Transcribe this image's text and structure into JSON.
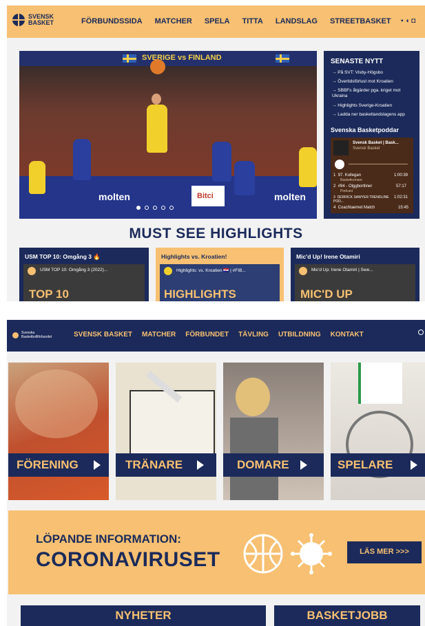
{
  "screen1": {
    "logo": {
      "line1": "SVENSK",
      "line2": "BASKET"
    },
    "nav": [
      "FÖRBUNDSSIDA",
      "MATCHER",
      "SPELA",
      "TITTA",
      "LANDSLAG",
      "STREETBASKET"
    ],
    "hero": {
      "banner_text": "SVERIGE vs FINLAND",
      "sponsor_left": "molten",
      "sponsor_right": "molten",
      "sponsor_mid": "Bitci",
      "slides": 5,
      "active_slide": 1
    },
    "news": {
      "title": "SENASTE NYTT",
      "items": [
        "→ På SVT: Visby-Högsbo",
        "→ Övertidsförlust mot Kroatien",
        "→ SBBFs åtgärder pga. kriget mot Ukraina",
        "→ Highlights Sverige-Kroatien",
        "→ Ladda ner basketlandslagens app"
      ],
      "podcast_title": "Svenska Basketpoddar",
      "podcast_show": "Svensk Basket | Bask...",
      "podcast_author": "Svensk Basket",
      "episodes": [
        {
          "n": "1",
          "title": "97. Kollegan",
          "sub": "Basketkomare",
          "time": "1:00:39"
        },
        {
          "n": "2",
          "title": "#94 - Olggbortliner",
          "sub": "Podcast",
          "time": "57:17"
        },
        {
          "n": "3",
          "title": "DERRICK SAWYER TRENDLINE POD...",
          "sub": "",
          "time": "1:02:31"
        },
        {
          "n": "4",
          "title": "Coachtaemet Match",
          "sub": "",
          "time": "15:45"
        }
      ]
    },
    "highlights_heading": "MUST SEE HIGHLIGHTS",
    "cards": [
      {
        "title": "USM TOP 10: Omgång 3 🔥",
        "video_title": "USM TOP 10: Omgång 3 (2022)...",
        "big": "TOP 10",
        "bg": "#1b2a5a",
        "fg": "#ffffff"
      },
      {
        "title": "Highlights vs. Kroatien!",
        "video_title": "Highlights: vs. Kroatien 🇭🇷 | #FIB...",
        "big": "HIGHLIGHTS",
        "bg": "#f7c072",
        "fg": "#1b2a5a"
      },
      {
        "title": "Mic'd Up! Irene Otamiri",
        "video_title": "Mic'd Up: Irene Otamiri | Swe...",
        "big": "MIC'D UP",
        "bg": "#1b2a5a",
        "fg": "#ffffff"
      }
    ]
  },
  "screen2": {
    "logo": {
      "line1": "Svenska",
      "line2": "Basketbollförbundet"
    },
    "nav": [
      "SVENSK BASKET",
      "MATCHER",
      "FÖRBUNDET",
      "TÄVLING",
      "UTBILDNING",
      "KONTAKT"
    ],
    "tiles": [
      {
        "label": "FÖRENING"
      },
      {
        "label": "TRÄNARE"
      },
      {
        "label": "DOMARE"
      },
      {
        "label": "SPELARE"
      }
    ],
    "corona": {
      "small": "LÖPANDE INFORMATION:",
      "big": "CORONAVIRUSET",
      "button": "LÄS MER >>>"
    },
    "bottom": [
      "NYHETER",
      "BASKETJOBB"
    ]
  },
  "colors": {
    "navy": "#1b2a5a",
    "gold": "#f7c072"
  }
}
